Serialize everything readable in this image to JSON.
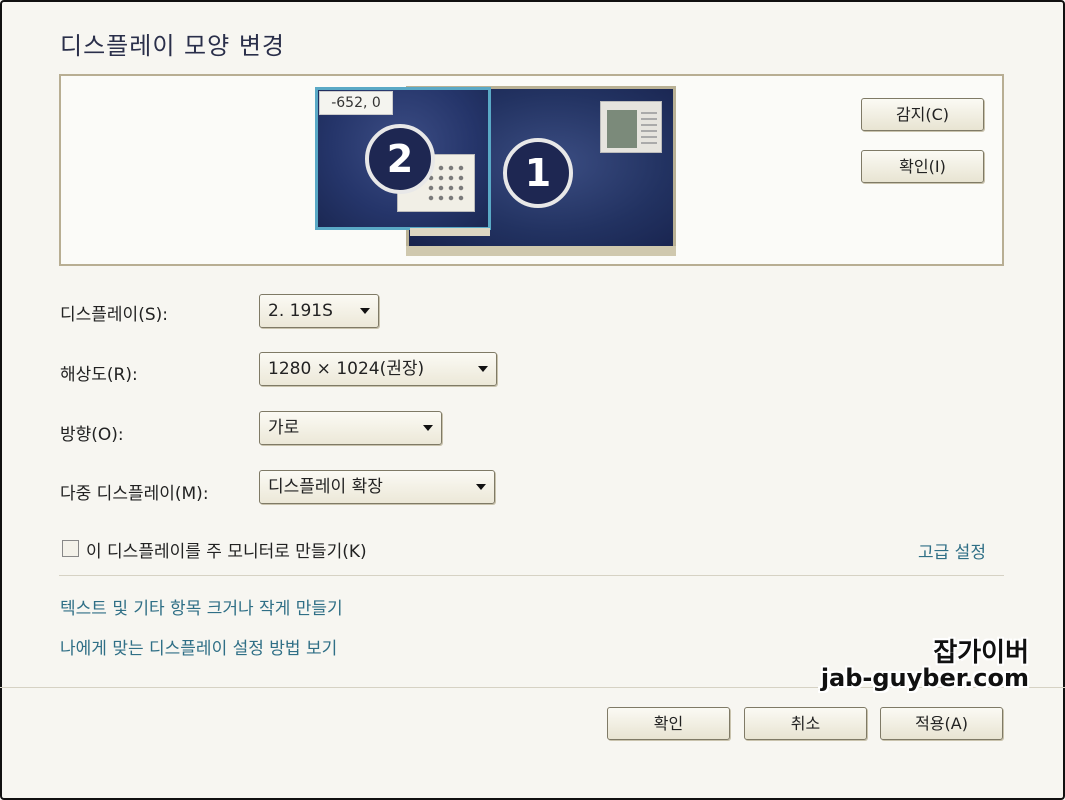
{
  "title": "디스플레이 모양 변경",
  "monitors": {
    "coord_label": "-652, 0",
    "monitor1_number": "1",
    "monitor2_number": "2"
  },
  "buttons": {
    "detect": "감지(C)",
    "identify": "확인(I)",
    "ok": "확인",
    "cancel": "취소",
    "apply": "적용(A)"
  },
  "fields": {
    "display": {
      "label": "디스플레이(S):",
      "value": "2. 191S"
    },
    "resolution": {
      "label": "해상도(R):",
      "value": "1280 × 1024(권장)"
    },
    "orientation": {
      "label": "방향(O):",
      "value": "가로"
    },
    "multiple_displays": {
      "label": "다중 디스플레이(M):",
      "value": "디스플레이 확장"
    }
  },
  "main_monitor_checkbox": {
    "label": "이 디스플레이를 주 모니터로 만들기(K)",
    "checked": false
  },
  "links": {
    "advanced": "고급 설정",
    "text_size": "텍스트 및 기타 항목 크거나 작게 만들기",
    "help": "나에게 맞는 디스플레이 설정 방법 보기"
  },
  "watermark": {
    "line1": "잡가이버",
    "line2": "jab-guyber.com"
  },
  "colors": {
    "link": "#2f6f86",
    "selected_monitor_border": "#5aa9c6",
    "monitor_fill": "#223261"
  }
}
